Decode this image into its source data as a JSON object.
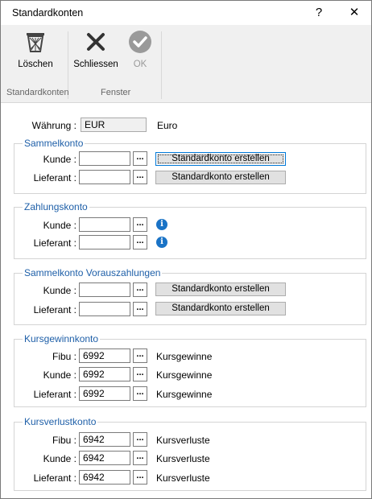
{
  "window": {
    "title": "Standardkonten",
    "help_label": "?",
    "close_label": "✕"
  },
  "ribbon": {
    "delete_label": "Löschen",
    "close_label": "Schliessen",
    "ok_label": "OK",
    "group_standardkonten": "Standardkonten",
    "group_fenster": "Fenster"
  },
  "currency": {
    "label": "Währung :",
    "code": "EUR",
    "name": "Euro"
  },
  "sammelkonto": {
    "title": "Sammelkonto",
    "rows": [
      {
        "label": "Kunde :",
        "value": "",
        "button": "Standardkonto erstellen"
      },
      {
        "label": "Lieferant :",
        "value": "",
        "button": "Standardkonto erstellen"
      }
    ]
  },
  "zahlungskonto": {
    "title": "Zahlungskonto",
    "rows": [
      {
        "label": "Kunde :",
        "value": ""
      },
      {
        "label": "Lieferant :",
        "value": ""
      }
    ]
  },
  "vorauszahlungen": {
    "title": "Sammelkonto Vorauszahlungen",
    "rows": [
      {
        "label": "Kunde :",
        "value": "",
        "button": "Standardkonto erstellen"
      },
      {
        "label": "Lieferant :",
        "value": "",
        "button": "Standardkonto erstellen"
      }
    ]
  },
  "kursgewinn": {
    "title": "Kursgewinnkonto",
    "rows": [
      {
        "label": "Fibu :",
        "value": "6992",
        "desc": "Kursgewinne"
      },
      {
        "label": "Kunde :",
        "value": "6992",
        "desc": "Kursgewinne"
      },
      {
        "label": "Lieferant :",
        "value": "6992",
        "desc": "Kursgewinne"
      }
    ]
  },
  "kursverlust": {
    "title": "Kursverlustkonto",
    "rows": [
      {
        "label": "Fibu :",
        "value": "6942",
        "desc": "Kursverluste"
      },
      {
        "label": "Kunde :",
        "value": "6942",
        "desc": "Kursverluste"
      },
      {
        "label": "Lieferant :",
        "value": "6942",
        "desc": "Kursverluste"
      }
    ]
  },
  "browse_label": "...",
  "info_glyph": "i",
  "colors": {
    "group_title": "#1e5fa8",
    "info_icon": "#1a73c6",
    "ribbon_bg": "#f0f0f0"
  }
}
